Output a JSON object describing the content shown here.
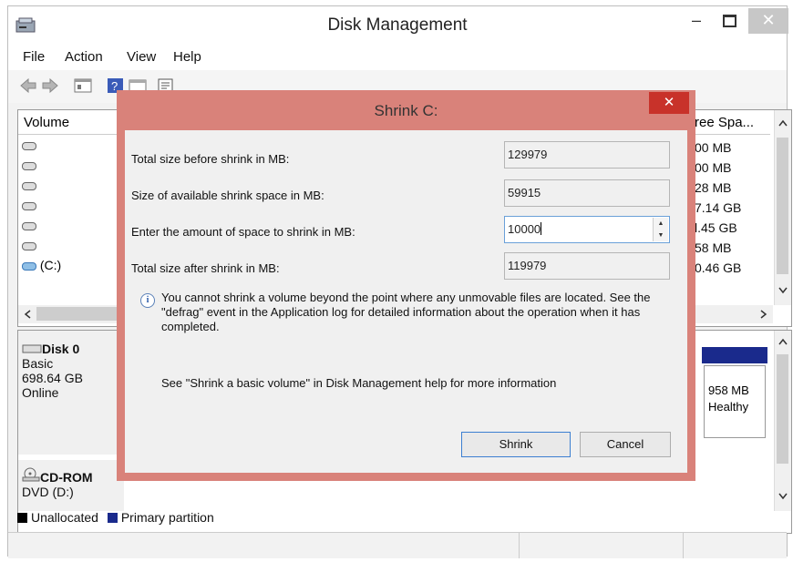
{
  "window": {
    "title": "Disk Management",
    "min": "–",
    "close": "✕"
  },
  "menu": [
    "File",
    "Action",
    "View",
    "Help"
  ],
  "volumes": {
    "col_volume": "Volume",
    "col_free": "ree Spa...",
    "rows": [
      {
        "name": "",
        "free": "00 MB"
      },
      {
        "name": "",
        "free": "00 MB"
      },
      {
        "name": "",
        "free": "28 MB"
      },
      {
        "name": "",
        "free": "7.14 GB"
      },
      {
        "name": "",
        "free": "l.45 GB"
      },
      {
        "name": "",
        "free": "58 MB"
      },
      {
        "name": "(C:)",
        "free": "0.46 GB"
      }
    ]
  },
  "disks": {
    "disk0": {
      "name": "Disk 0",
      "type": "Basic",
      "size": "698.64 GB",
      "status": "Online"
    },
    "partition": {
      "size": "958 MB",
      "status": "Healthy"
    },
    "cdrom": {
      "name": "CD-ROM",
      "drive": "DVD (D:)"
    }
  },
  "legend": {
    "unallocated": "Unallocated",
    "primary": "Primary partition"
  },
  "colors": {
    "unallocated": "#000000",
    "primary": "#1a2a8c",
    "dialog_frame": "#d9827a",
    "close_red": "#c8322a"
  },
  "dialog": {
    "title": "Shrink C:",
    "close": "✕",
    "fields": [
      {
        "label": "Total size before shrink in MB:",
        "value": "129979"
      },
      {
        "label": "Size of available shrink space in MB:",
        "value": "59915"
      },
      {
        "label": "Enter the amount of space to shrink in MB:",
        "value": "10000"
      },
      {
        "label": "Total size after shrink in MB:",
        "value": "119979"
      }
    ],
    "info_icon": "i",
    "info": "You cannot shrink a volume beyond the point where any unmovable files are located. See the \"defrag\" event in the Application log for detailed information about the operation when it has completed.",
    "help": "See \"Shrink a basic volume\" in Disk Management help for more information",
    "shrink_button": "Shrink",
    "cancel_button": "Cancel"
  }
}
